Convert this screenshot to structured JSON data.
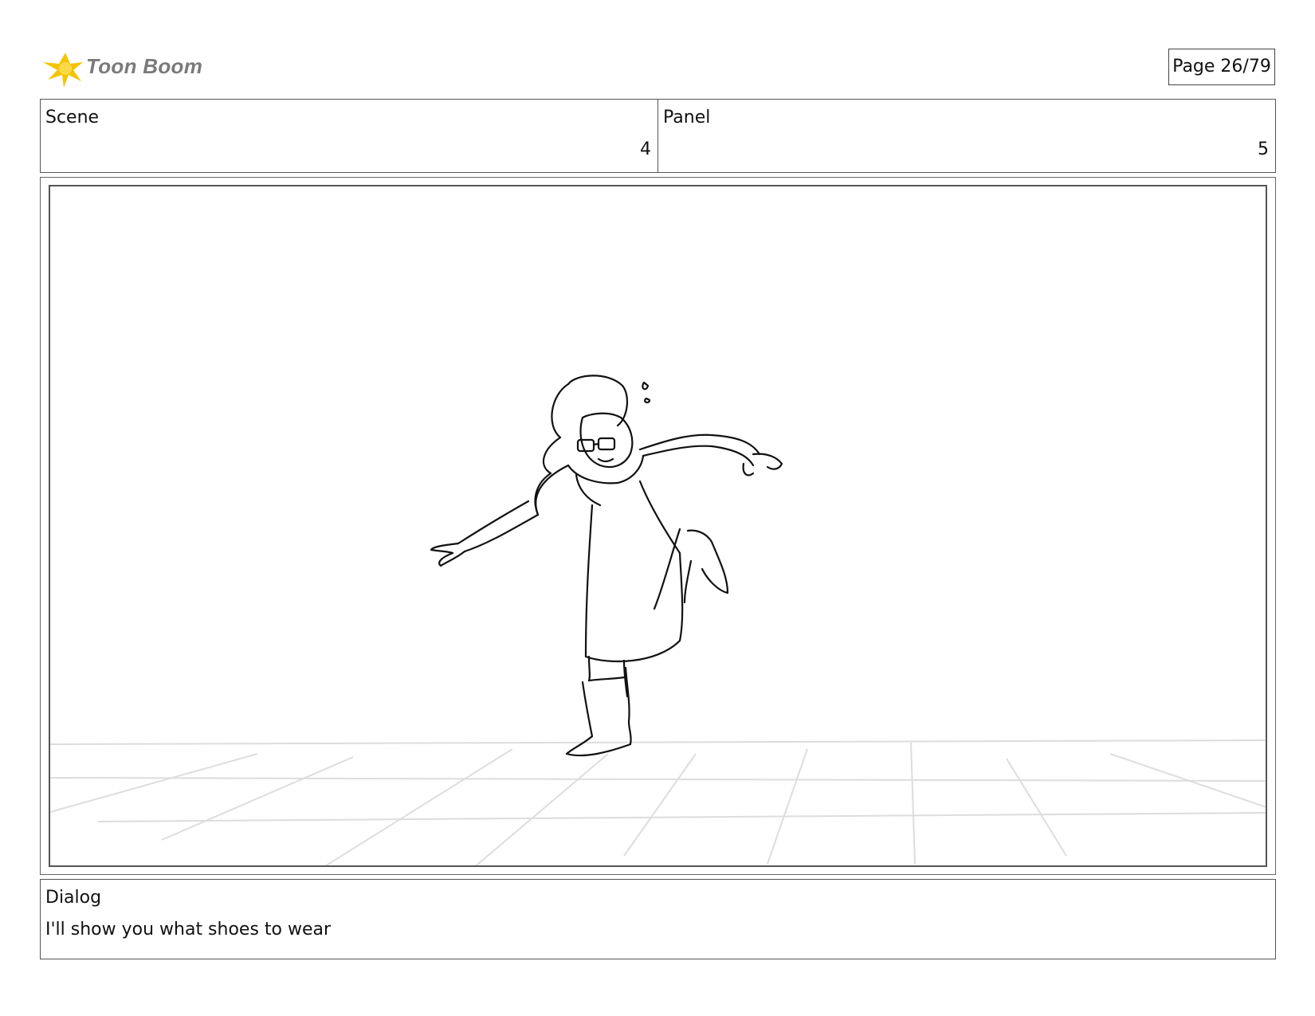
{
  "header": {
    "logo_text": "Toon Boom",
    "page_label": "Page 26/79"
  },
  "scene": {
    "label": "Scene",
    "value": "4"
  },
  "panel": {
    "label": "Panel",
    "value": "5"
  },
  "dialog": {
    "label": "Dialog",
    "text": "I'll show you what shoes to wear"
  },
  "colors": {
    "logo_star": "#f5c400",
    "logo_text": "#7a7a7a",
    "border": "#555555",
    "floor_grid": "#dddddd"
  },
  "icons": {
    "logo": "toon-boom-starburst-icon"
  }
}
